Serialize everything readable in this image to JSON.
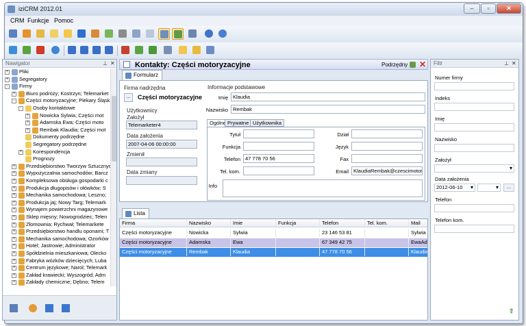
{
  "window": {
    "title": "iziCRM 2012.01"
  },
  "menu": [
    "CRM",
    "Funkcje",
    "Pomoc"
  ],
  "navigator": {
    "title": "Nawigator",
    "items": [
      {
        "label": "Pliki",
        "level": 0,
        "expander": "+",
        "color": "#8aa6d0"
      },
      {
        "label": "Segregatory",
        "level": 0,
        "expander": "+",
        "color": "#8aa6d0"
      },
      {
        "label": "Firmy",
        "level": 0,
        "expander": "-",
        "color": "#8aa6d0"
      },
      {
        "label": "Biuro podróży; Kostrzyn; Telemarket",
        "level": 1,
        "expander": "+",
        "color": "#e4a33b"
      },
      {
        "label": "Części motoryzacyjne; Piekary Śląsk",
        "level": 1,
        "expander": "-",
        "color": "#e4a33b"
      },
      {
        "label": "Osoby kontaktowe",
        "level": 2,
        "expander": "-",
        "color": "#f1cb5c"
      },
      {
        "label": "Nowicka Sylwia; Części mot",
        "level": 3,
        "expander": "+",
        "color": "#e4a33b"
      },
      {
        "label": "Adamska Ewa; Części moto",
        "level": 3,
        "expander": "+",
        "color": "#e4a33b"
      },
      {
        "label": "Rembak Klaudia; Części mot",
        "level": 3,
        "expander": "+",
        "color": "#e4a33b"
      },
      {
        "label": "Dokumenty podrzędne",
        "level": 2,
        "expander": "",
        "color": "#f1cb5c"
      },
      {
        "label": "Segregatory podrzędne",
        "level": 2,
        "expander": "",
        "color": "#f1cb5c"
      },
      {
        "label": "Korespondencja",
        "level": 2,
        "expander": "+",
        "color": "#f1cb5c"
      },
      {
        "label": "Prognozy",
        "level": 2,
        "expander": "",
        "color": "#f1cb5c"
      },
      {
        "label": "Przedsiębiorstwo Tworzyw Sztucznych",
        "level": 1,
        "expander": "+",
        "color": "#e4a33b"
      },
      {
        "label": "Wypożyczalnia samochodów; Barcz",
        "level": 1,
        "expander": "+",
        "color": "#e4a33b"
      },
      {
        "label": "Kompleksowa obsługa gospodarki c",
        "level": 1,
        "expander": "+",
        "color": "#e4a33b"
      },
      {
        "label": "Produkcja długopisów i ołówków; S",
        "level": 1,
        "expander": "+",
        "color": "#e4a33b"
      },
      {
        "label": "Mechanika samochodowa; Leszno;",
        "level": 1,
        "expander": "+",
        "color": "#e4a33b"
      },
      {
        "label": "Produkcja jaj; Nowy Targ; Telemark",
        "level": 1,
        "expander": "+",
        "color": "#e4a33b"
      },
      {
        "label": "Wynajem powierzchni magazynowe",
        "level": 1,
        "expander": "+",
        "color": "#e4a33b"
      },
      {
        "label": "Sklep mięsny; Nowogrodziec; Telen",
        "level": 1,
        "expander": "+",
        "color": "#e4a33b"
      },
      {
        "label": "Złomownia; Rychwał; Telemarkete",
        "level": 1,
        "expander": "+",
        "color": "#e4a33b"
      },
      {
        "label": "Przedsiębiorstwo handlu oponami; T",
        "level": 1,
        "expander": "+",
        "color": "#e4a33b"
      },
      {
        "label": "Mechanika samochodowa; Ozorków",
        "level": 1,
        "expander": "+",
        "color": "#e4a33b"
      },
      {
        "label": "Hotel; Jastrowie; Administrator",
        "level": 1,
        "expander": "+",
        "color": "#e4a33b"
      },
      {
        "label": "Spółdzielnia mieszkaniowa; Olecko",
        "level": 1,
        "expander": "+",
        "color": "#e4a33b"
      },
      {
        "label": "Fabryka wózków dziecięcych; Luba",
        "level": 1,
        "expander": "+",
        "color": "#e4a33b"
      },
      {
        "label": "Centrum językowe; Narol; Telemark",
        "level": 1,
        "expander": "+",
        "color": "#e4a33b"
      },
      {
        "label": "Zakład krawiecki; Wyszogród; Adm",
        "level": 1,
        "expander": "+",
        "color": "#e4a33b"
      },
      {
        "label": "Zakłady chemiczne; Dębno; Telem",
        "level": 1,
        "expander": "+",
        "color": "#e4a33b"
      }
    ]
  },
  "contact": {
    "header_title": "Kontakty: Części motoryzacyjne",
    "subordinate_label": "Podrzędny",
    "form_tab": "Formularz",
    "parent_company_label": "Firma nadrzędna",
    "parent_company_value": "Części motoryzacyjne",
    "users_label": "Użytkownicy",
    "created_by_label": "Założył",
    "created_by_value": "Telemarketer4",
    "created_date_label": "Data założenia",
    "created_date_value": "2007-04-06 00:00:00",
    "changed_by_label": "Zmienił",
    "changed_by_value": "",
    "changed_date_label": "Data zmiany",
    "changed_date_value": "",
    "basic_info_label": "Informacje podstawowe",
    "first_name_label": "Imię",
    "first_name_value": "Klaudia",
    "last_name_label": "Nazwisko",
    "last_name_value": "Rembak",
    "inner_tabs": [
      "Ogólne",
      "Prywatne",
      "Użytkownika"
    ],
    "title_label": "Tytuł",
    "function_label": "Funkcja",
    "phone_label": "Telefon",
    "phone_value": "47 778 70 56",
    "mobile_label": "Tel. kom.",
    "department_label": "Dział",
    "language_label": "Język",
    "fax_label": "Fax",
    "email_label": "Email",
    "email_value": "KlaudiaRembak@czescimotoryza",
    "info_label": "Info",
    "list_tab": "Lista"
  },
  "grid": {
    "columns": [
      "Firma",
      "Nazwisko",
      "Imie",
      "Funkcja",
      "Telefon",
      "Tel. kom.",
      "Mail"
    ],
    "rows": [
      [
        "Części motoryzacyjne",
        "Nowicka",
        "Sylwia",
        "",
        "23 146 53 81",
        "",
        "Sylwia"
      ],
      [
        "Części motoryzacyjne",
        "Adamska",
        "Ewa",
        "",
        "67 349 42 75",
        "",
        "EwaAd"
      ],
      [
        "Części motoryzacyjne",
        "Rembak",
        "Klaudia",
        "",
        "47 778 70 56",
        "",
        "Klaudia"
      ]
    ]
  },
  "filter": {
    "title": "Filtr",
    "fields": [
      "Numer firmy",
      "Indeks",
      "Imię",
      "Nazwisko",
      "Założył",
      "Data założenia",
      "Telefon",
      "Telefon kom."
    ],
    "date_value": "2012-06-10"
  },
  "colors": {
    "accent": "#3d8ee6",
    "selected_row": "#c8c3e8",
    "header": "#d4dcf2"
  }
}
